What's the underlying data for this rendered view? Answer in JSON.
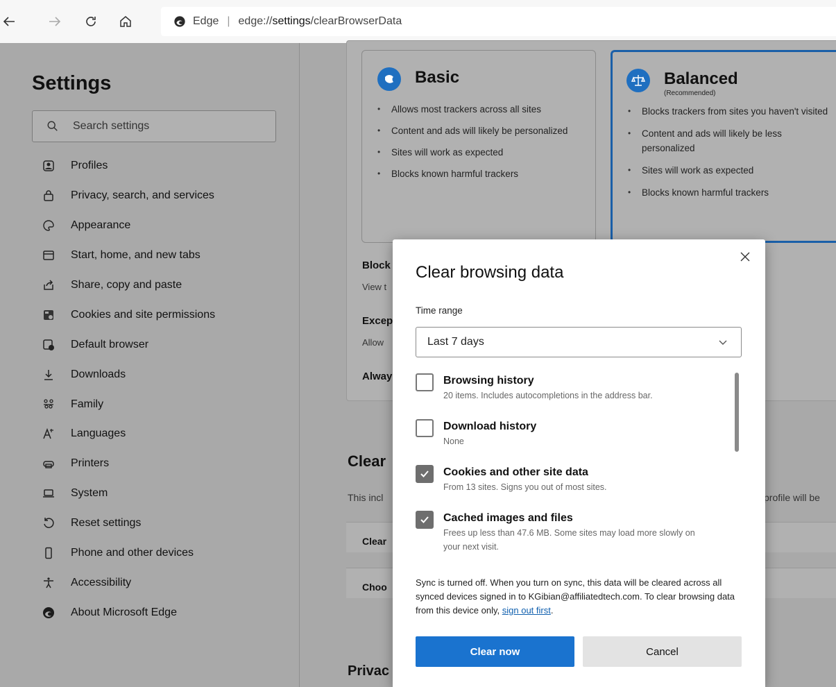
{
  "address_bar": {
    "site_name": "Edge",
    "url_prefix": "edge://",
    "url_bold": "settings",
    "url_suffix": "/clearBrowserData"
  },
  "sidebar": {
    "title": "Settings",
    "search_placeholder": "Search settings",
    "items": [
      {
        "label": "Profiles",
        "icon": "profile-icon"
      },
      {
        "label": "Privacy, search, and services",
        "icon": "lock-icon"
      },
      {
        "label": "Appearance",
        "icon": "palette-icon"
      },
      {
        "label": "Start, home, and new tabs",
        "icon": "window-icon"
      },
      {
        "label": "Share, copy and paste",
        "icon": "share-icon"
      },
      {
        "label": "Cookies and site permissions",
        "icon": "cookie-icon"
      },
      {
        "label": "Default browser",
        "icon": "browser-icon"
      },
      {
        "label": "Downloads",
        "icon": "download-icon"
      },
      {
        "label": "Family",
        "icon": "family-icon"
      },
      {
        "label": "Languages",
        "icon": "language-icon"
      },
      {
        "label": "Printers",
        "icon": "printer-icon"
      },
      {
        "label": "System",
        "icon": "laptop-icon"
      },
      {
        "label": "Reset settings",
        "icon": "reset-icon"
      },
      {
        "label": "Phone and other devices",
        "icon": "phone-icon"
      },
      {
        "label": "Accessibility",
        "icon": "accessibility-icon"
      },
      {
        "label": "About Microsoft Edge",
        "icon": "edge-logo-icon"
      }
    ]
  },
  "background": {
    "basic": {
      "title": "Basic",
      "bullets": [
        "Allows most trackers across all sites",
        "Content and ads will likely be personalized",
        "Sites will work as expected",
        "Blocks known harmful trackers"
      ]
    },
    "balanced": {
      "title": "Balanced",
      "subtitle": "(Recommended)",
      "bullets": [
        "Blocks trackers from sites you haven't visited",
        "Content and ads will likely be less personalized",
        "Sites will work as expected",
        "Blocks known harmful trackers"
      ]
    },
    "fragments": {
      "block": "Block",
      "view": "View t",
      "excep": "Excep",
      "allow": "Allow",
      "alway": "Alway",
      "clear_heading": "Clear",
      "this_incl": "This incl",
      "profile_will_be": "profile will be",
      "clear_row": "Clear",
      "choo_row": "Choo",
      "privac": "Privac"
    }
  },
  "dialog": {
    "title": "Clear browsing data",
    "time_range_label": "Time range",
    "time_range_value": "Last 7 days",
    "items": [
      {
        "name": "Browsing history",
        "desc": "20 items. Includes autocompletions in the address bar.",
        "checked": false
      },
      {
        "name": "Download history",
        "desc": "None",
        "checked": false
      },
      {
        "name": "Cookies and other site data",
        "desc": "From 13 sites. Signs you out of most sites.",
        "checked": true
      },
      {
        "name": "Cached images and files",
        "desc": "Frees up less than 47.6 MB. Some sites may load more slowly on your next visit.",
        "checked": true
      }
    ],
    "sync_text": "Sync is turned off. When you turn on sync, this data will be cleared across all synced devices signed in to KGibian@affiliatedtech.com. To clear browsing data from this device only,",
    "sync_link": "sign out first",
    "sync_end": ".",
    "clear_button": "Clear now",
    "cancel_button": "Cancel"
  },
  "colors": {
    "primary": "#1a73cf",
    "link": "#0f5fae",
    "overlay": "#a9a9a9",
    "selected_border": "#1a5fa8"
  }
}
